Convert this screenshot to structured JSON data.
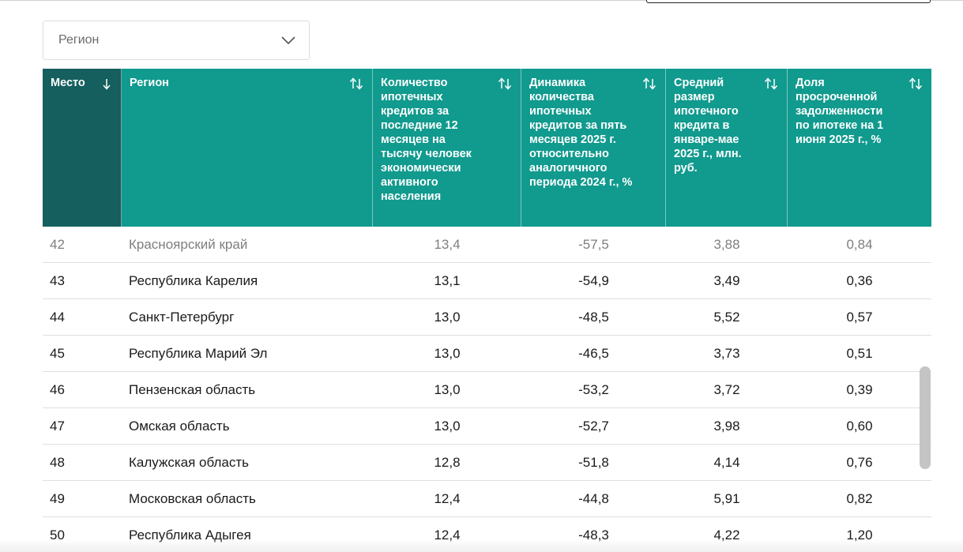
{
  "filter": {
    "placeholder": "Регион"
  },
  "table": {
    "columns": [
      {
        "key": "rank",
        "label": "Место",
        "sort": "desc-active"
      },
      {
        "key": "region",
        "label": "Регион",
        "sort": "both"
      },
      {
        "key": "count",
        "label": "Количество ипотечных кредитов за последние 12 месяцев на тысячу человек экономически активного населения",
        "sort": "both"
      },
      {
        "key": "dynamics",
        "label": "Динамика количества ипотечных кредитов за пять месяцев 2025 г. относительно аналогичного периода 2024 г., %",
        "sort": "both"
      },
      {
        "key": "avg_size",
        "label": "Средний размер ипотечного кредита в январе-мае 2025 г., млн. руб.",
        "sort": "both"
      },
      {
        "key": "overdue_share",
        "label": "Доля просроченной задолженности по ипотеке на 1 июня 2025 г., %",
        "sort": "both"
      }
    ],
    "rows": [
      {
        "rank": "42",
        "region": "Красноярский край",
        "count": "13,4",
        "dynamics": "-57,5",
        "avg_size": "3,88",
        "overdue_share": "0,84"
      },
      {
        "rank": "43",
        "region": "Республика Карелия",
        "count": "13,1",
        "dynamics": "-54,9",
        "avg_size": "3,49",
        "overdue_share": "0,36"
      },
      {
        "rank": "44",
        "region": "Санкт-Петербург",
        "count": "13,0",
        "dynamics": "-48,5",
        "avg_size": "5,52",
        "overdue_share": "0,57"
      },
      {
        "rank": "45",
        "region": "Республика Марий Эл",
        "count": "13,0",
        "dynamics": "-46,5",
        "avg_size": "3,73",
        "overdue_share": "0,51"
      },
      {
        "rank": "46",
        "region": "Пензенская область",
        "count": "13,0",
        "dynamics": "-53,2",
        "avg_size": "3,72",
        "overdue_share": "0,39"
      },
      {
        "rank": "47",
        "region": "Омская область",
        "count": "13,0",
        "dynamics": "-52,7",
        "avg_size": "3,98",
        "overdue_share": "0,60"
      },
      {
        "rank": "48",
        "region": "Калужская область",
        "count": "12,8",
        "dynamics": "-51,8",
        "avg_size": "4,14",
        "overdue_share": "0,76"
      },
      {
        "rank": "49",
        "region": "Московская область",
        "count": "12,4",
        "dynamics": "-44,8",
        "avg_size": "5,91",
        "overdue_share": "0,82"
      },
      {
        "rank": "50",
        "region": "Республика Адыгея",
        "count": "12,4",
        "dynamics": "-48,3",
        "avg_size": "4,22",
        "overdue_share": "1,20"
      }
    ]
  },
  "colors": {
    "header_teal": "#119a8e",
    "header_active": "#155f5e"
  }
}
